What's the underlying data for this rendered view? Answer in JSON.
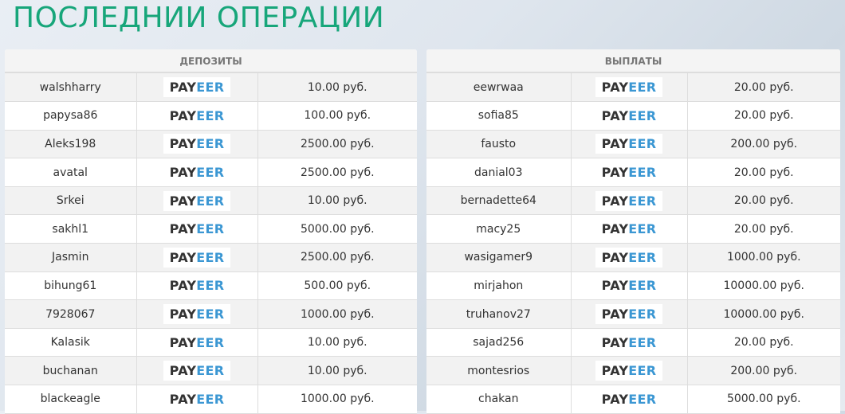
{
  "title": "ПОСЛЕДНИИ ОПЕРАЦИИ",
  "payment_logo": {
    "part1": "PAY",
    "part2": "EER"
  },
  "deposits": {
    "header": "ДЕПОЗИТЫ",
    "rows": [
      {
        "user": "walshharry",
        "amount": "10.00 руб."
      },
      {
        "user": "papysa86",
        "amount": "100.00 руб."
      },
      {
        "user": "Aleks198",
        "amount": "2500.00 руб."
      },
      {
        "user": "avatal",
        "amount": "2500.00 руб."
      },
      {
        "user": "Srkei",
        "amount": "10.00 руб."
      },
      {
        "user": "sakhl1",
        "amount": "5000.00 руб."
      },
      {
        "user": "Jasmin",
        "amount": "2500.00 руб."
      },
      {
        "user": "bihung61",
        "amount": "500.00 руб."
      },
      {
        "user": "7928067",
        "amount": "1000.00 руб."
      },
      {
        "user": "Kalasik",
        "amount": "10.00 руб."
      },
      {
        "user": "buchanan",
        "amount": "10.00 руб."
      },
      {
        "user": "blackeagle",
        "amount": "1000.00 руб."
      }
    ]
  },
  "withdrawals": {
    "header": "ВЫПЛАТЫ",
    "rows": [
      {
        "user": "eewrwaa",
        "amount": "20.00 руб."
      },
      {
        "user": "sofia85",
        "amount": "20.00 руб."
      },
      {
        "user": "fausto",
        "amount": "200.00 руб."
      },
      {
        "user": "danial03",
        "amount": "20.00 руб."
      },
      {
        "user": "bernadette64",
        "amount": "20.00 руб."
      },
      {
        "user": "macy25",
        "amount": "20.00 руб."
      },
      {
        "user": "wasigamer9",
        "amount": "1000.00 руб."
      },
      {
        "user": "mirjahon",
        "amount": "10000.00 руб."
      },
      {
        "user": "truhanov27",
        "amount": "10000.00 руб."
      },
      {
        "user": "sajad256",
        "amount": "20.00 руб."
      },
      {
        "user": "montesrios",
        "amount": "200.00 руб."
      },
      {
        "user": "chakan",
        "amount": "5000.00 руб."
      }
    ]
  }
}
